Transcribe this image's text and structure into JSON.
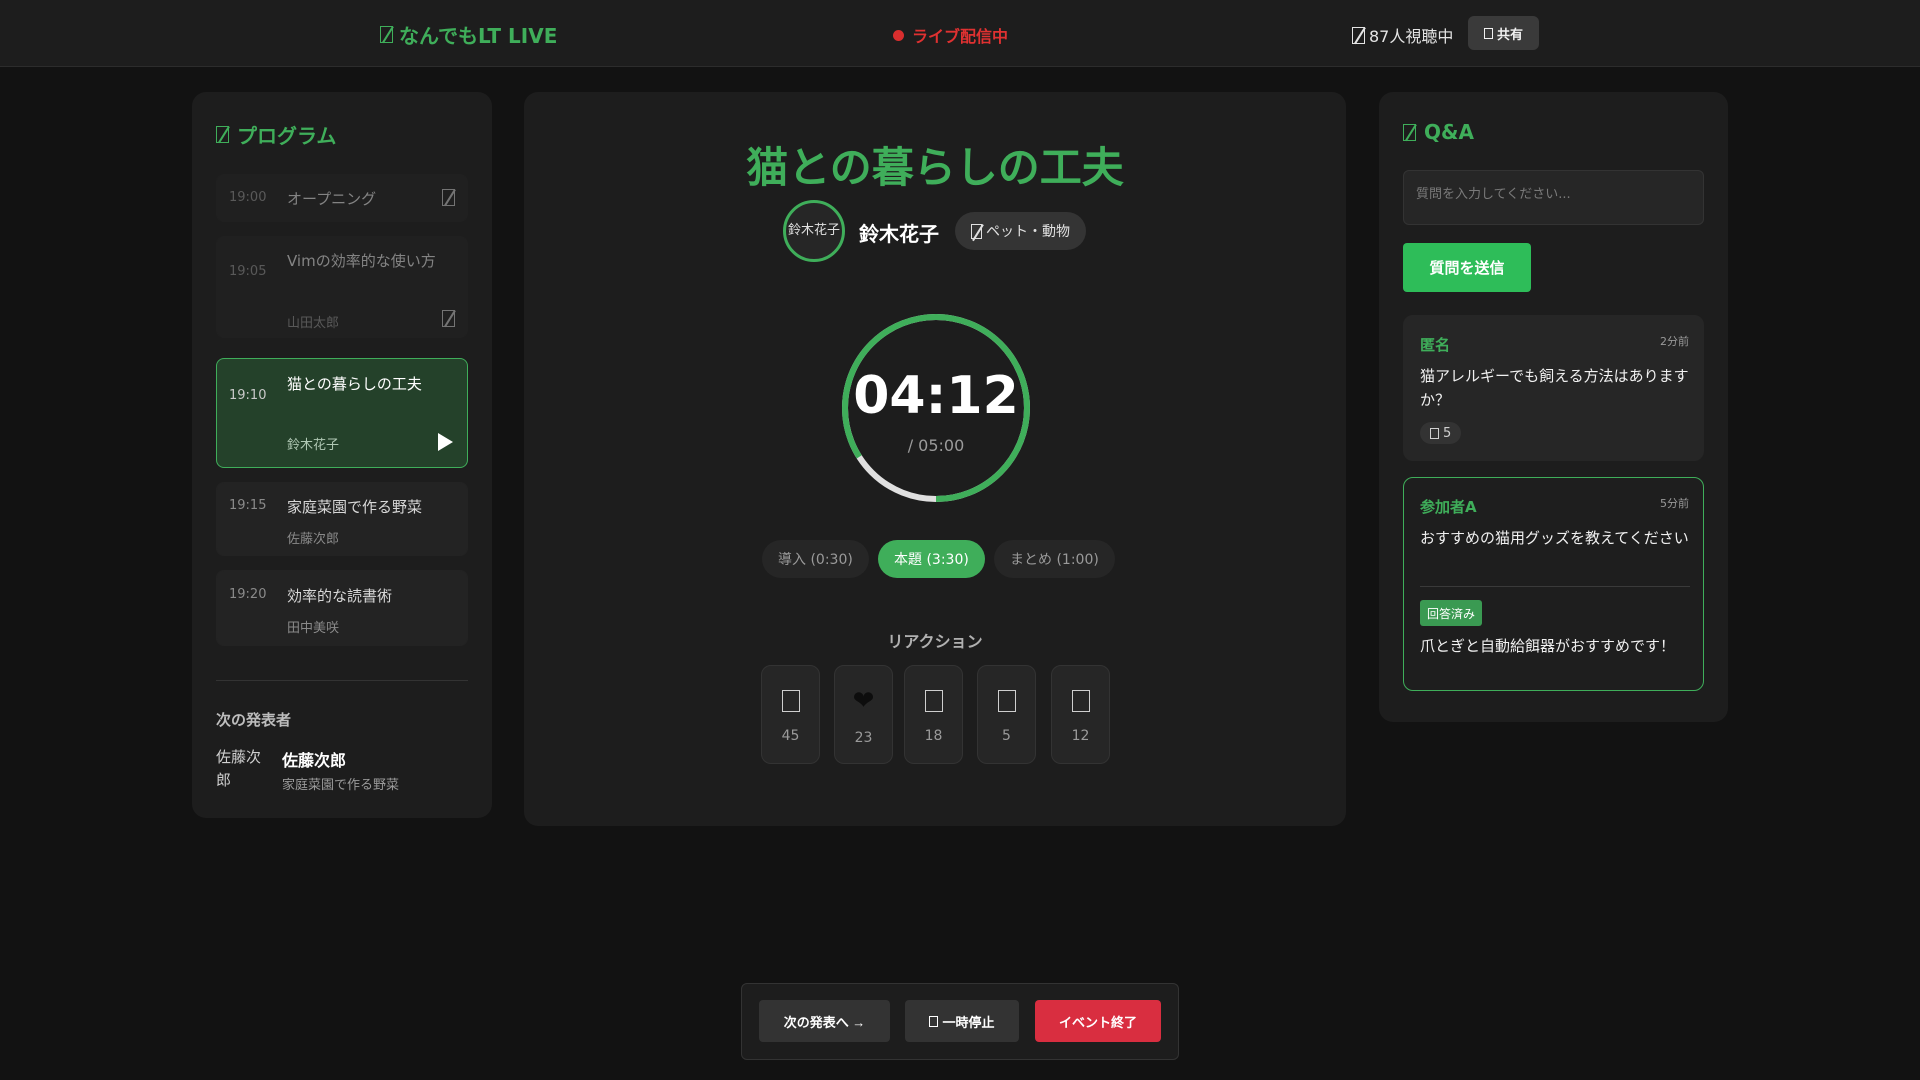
{
  "header": {
    "title": "なんでもLT LIVE",
    "live_status": "ライブ配信中",
    "viewers": "87人視聴中",
    "share_label": "共有"
  },
  "program": {
    "title": "プログラム",
    "items": [
      {
        "time": "19:00",
        "title": "オープニング",
        "speaker": "",
        "status": "done"
      },
      {
        "time": "19:05",
        "title": "Vimの効率的な使い方",
        "speaker": "山田太郎",
        "status": "done"
      },
      {
        "time": "19:10",
        "title": "猫との暮らしの工夫",
        "speaker": "鈴木花子",
        "status": "active"
      },
      {
        "time": "19:15",
        "title": "家庭菜園で作る野菜",
        "speaker": "佐藤次郎",
        "status": "upcoming"
      },
      {
        "time": "19:20",
        "title": "効率的な読書術",
        "speaker": "田中美咲",
        "status": "upcoming"
      }
    ],
    "next": {
      "label": "次の発表者",
      "avatar_alt": "佐藤次郎",
      "name": "佐藤次郎",
      "topic": "家庭菜園で作る野菜"
    }
  },
  "current_talk": {
    "title": "猫との暮らしの工夫",
    "speaker_avatar_alt": "鈴木花子",
    "speaker": "鈴木花子",
    "category": "ペット・動物",
    "timer": {
      "remaining": "04:12",
      "total": "/ 05:00",
      "progress": 0.84
    },
    "phases": [
      {
        "label": "導入 (0:30)",
        "active": false
      },
      {
        "label": "本題 (3:30)",
        "active": true
      },
      {
        "label": "まとめ (1:00)",
        "active": false
      }
    ],
    "reactions_label": "リアクション",
    "reactions": [
      {
        "icon": "clap-icon",
        "count": "45"
      },
      {
        "icon": "heart-icon",
        "count": "23"
      },
      {
        "icon": "laugh-icon",
        "count": "18"
      },
      {
        "icon": "surprise-icon",
        "count": "5"
      },
      {
        "icon": "bulb-icon",
        "count": "12"
      }
    ]
  },
  "qa": {
    "title": "Q&A",
    "input_placeholder": "質問を入力してください...",
    "submit_label": "質問を送信",
    "questions": [
      {
        "author": "匿名",
        "time": "2分前",
        "text": "猫アレルギーでも飼える方法はありますか？",
        "likes": "5",
        "answered": false
      },
      {
        "author": "参加者A",
        "time": "5分前",
        "text": "おすすめの猫用グッズを教えてください",
        "answered": true,
        "answered_label": "回答済み",
        "answer": "爪とぎと自動給餌器がおすすめです！"
      }
    ]
  },
  "controls": {
    "next_label": "次の発表へ →",
    "pause_label": "一時停止",
    "end_label": "イベント終了"
  },
  "colors": {
    "accent": "#3fae5a",
    "live": "#e03131",
    "end_button": "#d92e40",
    "background": "#121212"
  }
}
